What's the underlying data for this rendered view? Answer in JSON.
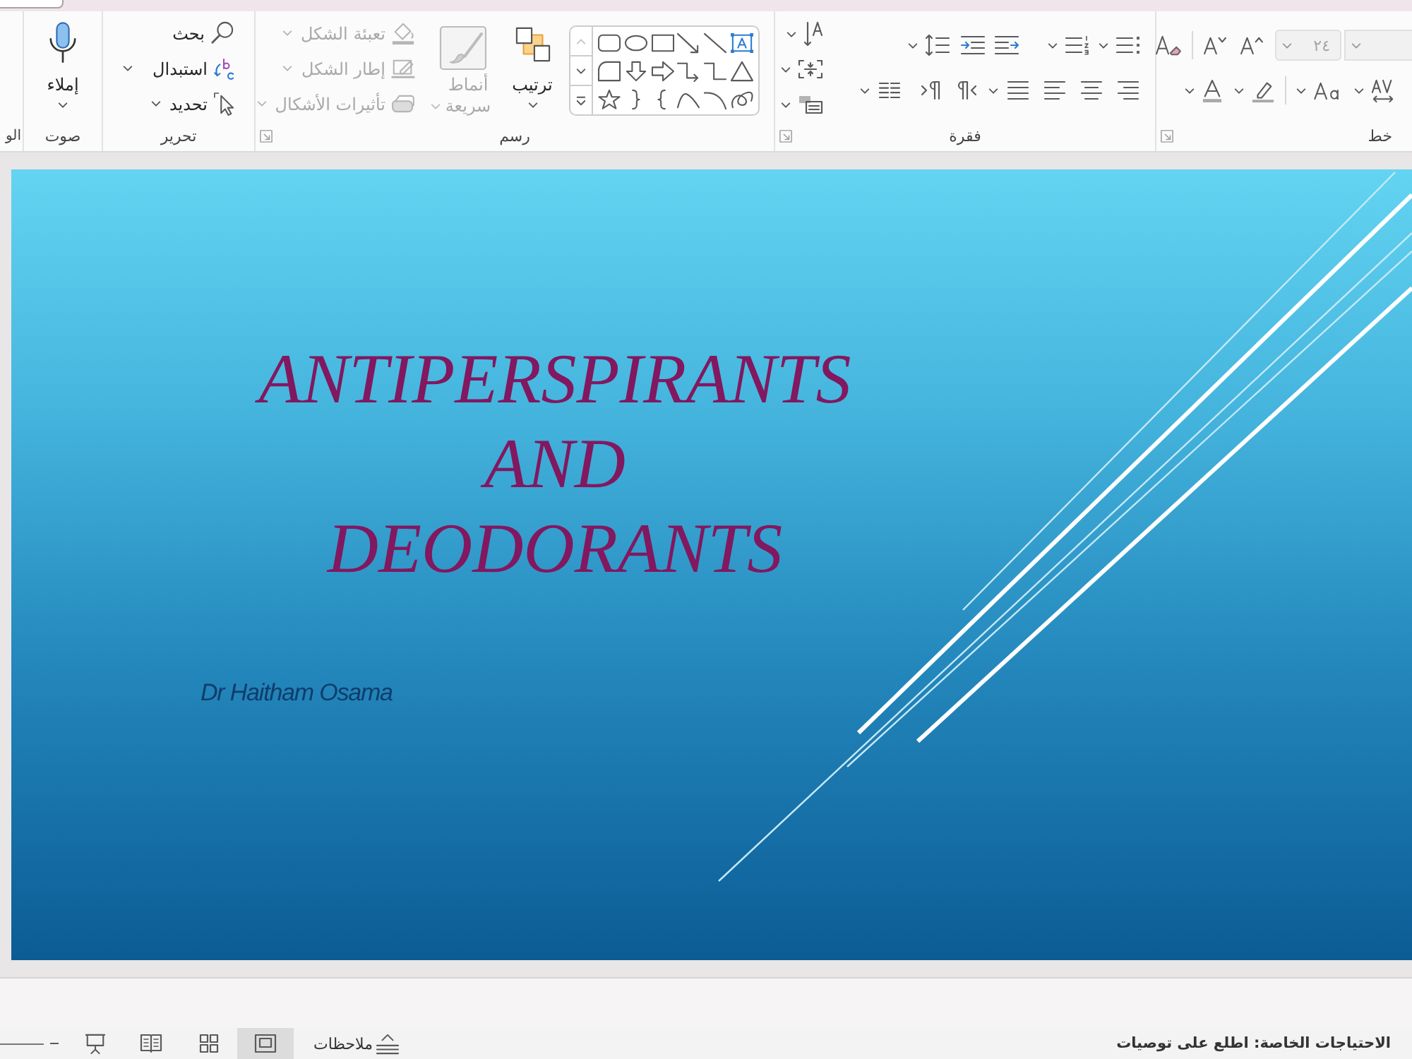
{
  "ribbon": {
    "groups": [
      {
        "kind": "font",
        "label": "خط",
        "font_name": {
          "disabled": true
        },
        "font_size": {
          "value": "٢٤",
          "disabled": true
        }
      },
      {
        "kind": "paragraph",
        "label": "فقرة"
      },
      {
        "kind": "drawing",
        "label": "رسم",
        "arrange": "ترتيب",
        "quick_styles": {
          "label": "أنماط سريعة",
          "disabled": true
        },
        "shape_commands": [
          {
            "label": "تعبئة الشكل",
            "disabled": true
          },
          {
            "label": "إطار الشكل",
            "disabled": true
          },
          {
            "label": "تأثيرات الأشكال",
            "disabled": true
          }
        ]
      },
      {
        "kind": "editing",
        "label": "تحرير",
        "commands": [
          {
            "kind": "find",
            "label": "بحث"
          },
          {
            "kind": "replace",
            "label": "استبدال"
          },
          {
            "kind": "select",
            "label": "تحديد"
          }
        ]
      },
      {
        "kind": "voice",
        "label": "صوت",
        "dictate": "إملاء"
      },
      {
        "kind": "partial",
        "label": "الو"
      }
    ]
  },
  "slide": {
    "title_lines": [
      "ANTIPERSPIRANTS",
      "AND",
      "DEODORANTS"
    ],
    "subtitle": "Dr Haitham Osama"
  },
  "status_bar": {
    "accessibility": "الاحتياجات الخاصة: اطلع على توصيات",
    "notes": "ملاحظات",
    "views": [
      {
        "kind": "normal",
        "selected": true
      },
      {
        "kind": "sorter",
        "selected": false
      },
      {
        "kind": "reading",
        "selected": false
      },
      {
        "kind": "slideshow",
        "selected": false
      }
    ]
  }
}
